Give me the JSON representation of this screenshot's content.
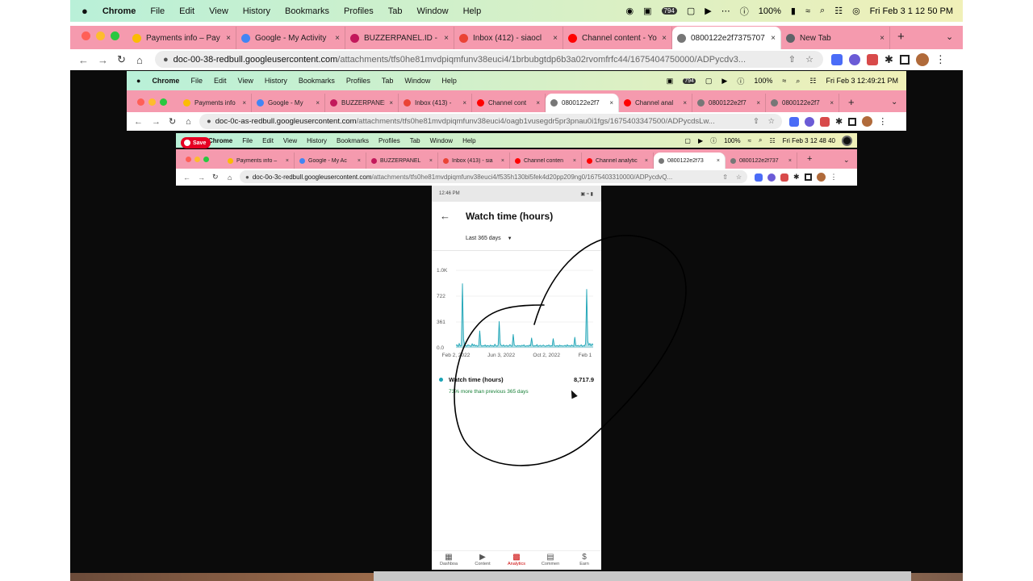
{
  "outer": {
    "menubar": {
      "apple": "",
      "app": "Chrome",
      "items": [
        "File",
        "Edit",
        "View",
        "History",
        "Bookmarks",
        "Profiles",
        "Tab",
        "Window",
        "Help"
      ],
      "battery": "100%",
      "clock": "Fri Feb 3  1 12 50 PM",
      "badge": "794"
    },
    "tabs": [
      {
        "title": "Payments info – Pay",
        "color": "#fbbc04"
      },
      {
        "title": "Google - My Activity",
        "color": "#4285f4"
      },
      {
        "title": "BUZZERPANEL.ID -",
        "color": "#c2185b"
      },
      {
        "title": "Inbox (412) - siaocl",
        "color": "#ea4335"
      },
      {
        "title": "Channel content - Yo",
        "color": "#ff0000"
      },
      {
        "title": "0800122e2f7375707",
        "color": "#777777",
        "active": true
      },
      {
        "title": "New Tab",
        "color": "#5f6368"
      }
    ],
    "url_host": "doc-00-38-redbull.googleusercontent.com",
    "url_path": "/attachments/tfs0he81mvdpiqmfunv38euci4/1brbubgtdp6b3a02rvomfrfc44/1675404750000/ADPycdv3..."
  },
  "mid": {
    "menubar": {
      "app": "Chrome",
      "items": [
        "File",
        "Edit",
        "View",
        "History",
        "Bookmarks",
        "Profiles",
        "Tab",
        "Window",
        "Help"
      ],
      "battery": "100%",
      "clock": "Fri Feb 3  12:49:21 PM",
      "badge": "794"
    },
    "tabs": [
      {
        "title": "Payments info",
        "color": "#fbbc04"
      },
      {
        "title": "Google - My",
        "color": "#4285f4"
      },
      {
        "title": "BUZZERPANEL",
        "color": "#c2185b"
      },
      {
        "title": "Inbox (413) -",
        "color": "#ea4335"
      },
      {
        "title": "Channel cont",
        "color": "#ff0000"
      },
      {
        "title": "0800122e2f7",
        "color": "#777777",
        "active": true
      },
      {
        "title": "Channel anal",
        "color": "#ff0000"
      },
      {
        "title": "0800122e2f7",
        "color": "#777777"
      },
      {
        "title": "0800122e2f7",
        "color": "#777777"
      }
    ],
    "url_host": "doc-0c-as-redbull.googleusercontent.com",
    "url_path": "/attachments/tfs0he81mvdpiqmfunv38euci4/oagb1vusegdr5pr3pnau0i1fgs/1675403347500/ADPycdsLw..."
  },
  "inner": {
    "save_label": "Save",
    "menubar": {
      "app": "Chrome",
      "items": [
        "File",
        "Edit",
        "View",
        "History",
        "Bookmarks",
        "Profiles",
        "Tab",
        "Window",
        "Help"
      ],
      "battery": "100%",
      "clock": "Fri Feb 3  12 48 40"
    },
    "tabs": [
      {
        "title": "Payments info –",
        "color": "#fbbc04"
      },
      {
        "title": "Google - My Ac",
        "color": "#4285f4"
      },
      {
        "title": "BUZZERPANEL",
        "color": "#c2185b"
      },
      {
        "title": "Inbox (413) - sia",
        "color": "#ea4335"
      },
      {
        "title": "Channel conten",
        "color": "#ff0000"
      },
      {
        "title": "Channel analytic",
        "color": "#ff0000"
      },
      {
        "title": "0800122e2f73",
        "color": "#777777",
        "active": true
      },
      {
        "title": "0800122e2f737",
        "color": "#777777"
      }
    ],
    "url_host": "doc-0o-3c-redbull.googleusercontent.com",
    "url_path": "/attachments/tfs0he81mvdpiqmfunv38euci4/f535h130bl5fek4d20pp209ng0/1675403310000/ADPycdvQ..."
  },
  "phone": {
    "status_time": "12:46 PM",
    "title": "Watch time (hours)",
    "range_label": "Last 365 days",
    "metric_label": "Watch time (hours)",
    "metric_value": "8,717.9",
    "metric_change": "73% more than previous 365 days",
    "nav": [
      "Dashboa",
      "Content",
      "Analytics",
      "Commen",
      "Earn"
    ],
    "accent": "#1aa3b5",
    "nav_active": "#cc0000"
  },
  "chart_data": {
    "type": "area",
    "yticks": [
      "1.0K",
      "722",
      "361",
      "0.0"
    ],
    "xticks": [
      "Feb 2, 2022",
      "Jun 3, 2022",
      "Oct 2, 2022",
      "Feb 1"
    ],
    "ylim": [
      0,
      1083
    ],
    "grid": true,
    "series": [
      {
        "name": "Watch time (hours)",
        "values": [
          35,
          42,
          18,
          60,
          25,
          30,
          900,
          120,
          50,
          30,
          22,
          40,
          35,
          28,
          20,
          55,
          30,
          45,
          25,
          35,
          20,
          28,
          240,
          38,
          22,
          30,
          25,
          40,
          20,
          32,
          28,
          22,
          38,
          25,
          30,
          20,
          50,
          28,
          22,
          35,
          370,
          60,
          30,
          25,
          40,
          22,
          28,
          35,
          20,
          30,
          45,
          25,
          22,
          190,
          38,
          28,
          20,
          32,
          25,
          30,
          22,
          35,
          28,
          40,
          20,
          25,
          30,
          22,
          38,
          28,
          140,
          35,
          22,
          30,
          25,
          45,
          20,
          28,
          35,
          22,
          30,
          38,
          25,
          20,
          32,
          28,
          40,
          22,
          30,
          25,
          130,
          35,
          22,
          28,
          30,
          20,
          38,
          25,
          30,
          22,
          28,
          35,
          20,
          42,
          25,
          30,
          22,
          38,
          28,
          20,
          150,
          30,
          25,
          35,
          22,
          28,
          40,
          20,
          30,
          25,
          60,
          820,
          90,
          40,
          60,
          30,
          55,
          45
        ]
      }
    ]
  }
}
